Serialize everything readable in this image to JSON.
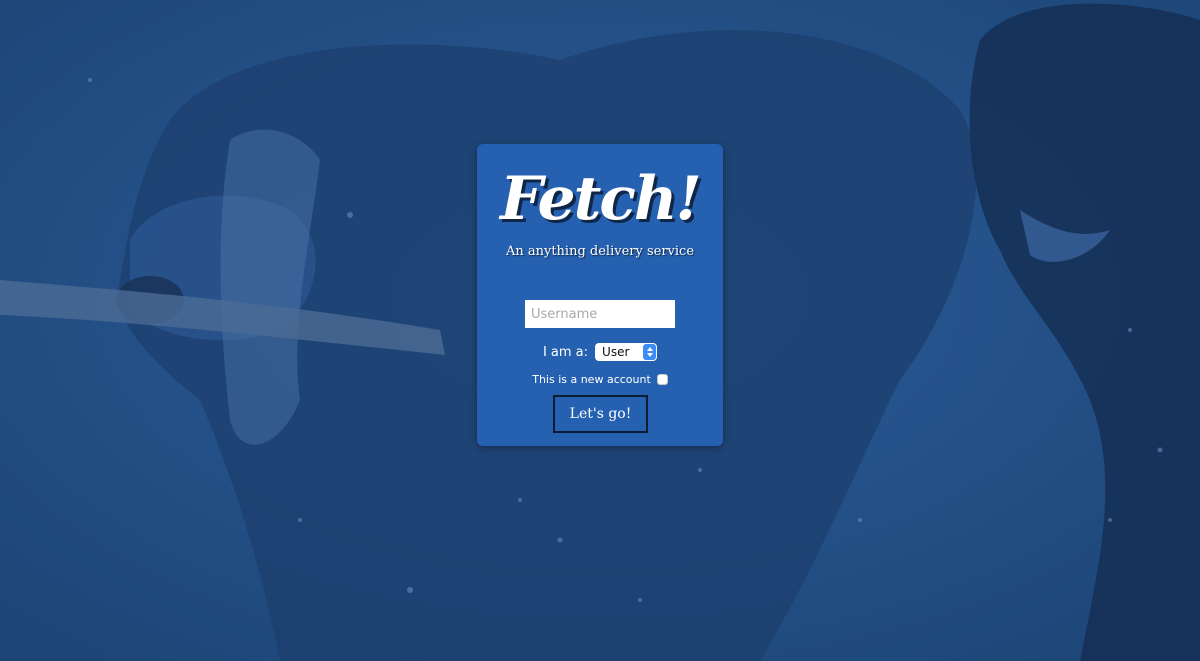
{
  "app": {
    "title": "Fetch!",
    "tagline": "An anything delivery service"
  },
  "form": {
    "username_placeholder": "Username",
    "username_value": "",
    "role_label": "I am a:",
    "role_selected": "User",
    "new_account_label": "This is a new account",
    "new_account_checked": false,
    "submit_label": "Let's go!"
  },
  "colors": {
    "background_overlay": "#234f86",
    "card": "#2561b0",
    "select_arrow_accent": "#3c8df3"
  }
}
